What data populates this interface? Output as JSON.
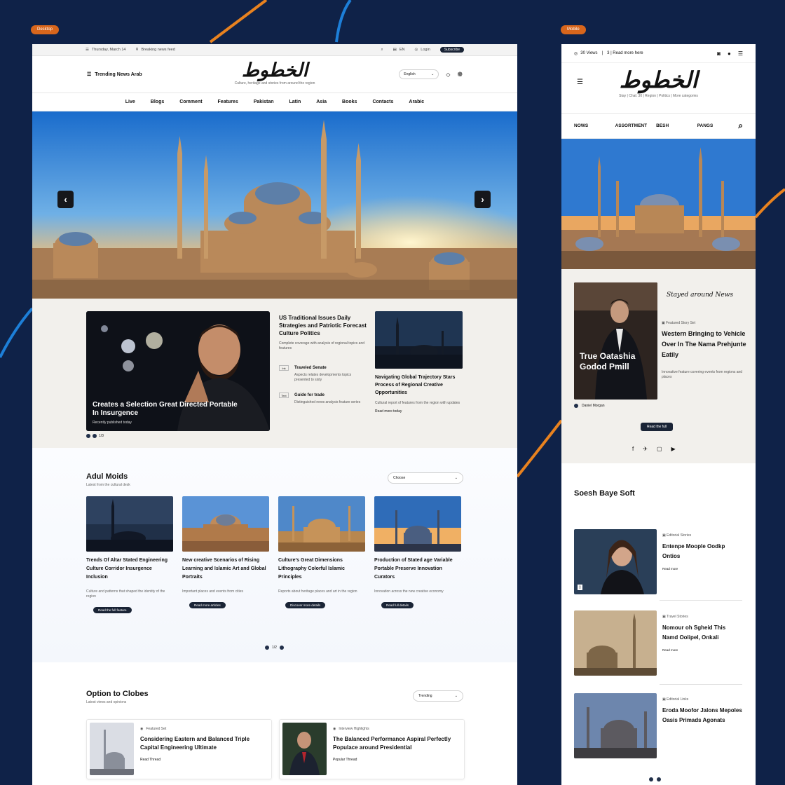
{
  "badges": {
    "left": "Desktop",
    "right": "Mobile"
  },
  "desktop": {
    "util": {
      "left1": "Thursday, March 14",
      "left2": "Breaking news feed",
      "right1": "EN",
      "right2": "Login",
      "button": "Subscribe"
    },
    "header": {
      "menu_label": "Trending News Arab",
      "logo": "الخطوط",
      "tagline": "Culture, heritage and stories from around the region",
      "lang_select": "English"
    },
    "nav": [
      "Live",
      "Blogs",
      "Comment",
      "Features",
      "Pakistan",
      "Latin",
      "Asia",
      "Books",
      "Contacts",
      "Arabic"
    ],
    "featured": {
      "main_title": "Creates a Selection Great Directed Portable In Insurgence",
      "main_meta": "Recently published today",
      "dots_label": "1/3",
      "mid_lead": "US Traditional Issues Daily Strategies and Patriotic Forecast Culture Politics",
      "mid_sub": "Complete coverage with analysis of regional topics and features",
      "mini": [
        {
          "tag": "Ink",
          "title": "Traveled Senate",
          "desc": "Aspects relates developments topics presented to sixty"
        },
        {
          "tag": "Text",
          "title": "Guide for trade",
          "desc": "Distinguished news analysis feature series"
        }
      ],
      "right_title": "Navigating Global Trajectory Stars Process of Regional Creative Opportunities",
      "right_desc": "Cultural report of features from the region with updates",
      "right_more": "Read more today"
    },
    "section2": {
      "title": "Adul Moids",
      "subtitle": "Latest from the cultural desk",
      "select": "Choose",
      "cards": [
        {
          "title": "Trends Of Altar Stated Engineering Culture Corridor Insurgence Inclusion",
          "desc": "Culture and patterns that shaped the identity of the region",
          "button": "Read the full feature"
        },
        {
          "title": "New creative Scenarios of Rising Learning and Islamic Art and Global Portraits",
          "desc": "Important places and events from cities",
          "button": "Read more articles"
        },
        {
          "title": "Culture's Great Dimensions Lithography Colorful Islamic Principles",
          "desc": "Reports about heritage places and art in the region",
          "button": "Discover more details"
        },
        {
          "title": "Production of Stated age Variable Portable Preserve Innovation Curators",
          "desc": "Innovation across the new creative economy",
          "button": "Read full details"
        }
      ],
      "pager": "1/2"
    },
    "section3": {
      "title": "Option to Clobes",
      "subtitle": "Latest views and opinions",
      "select": "Trending",
      "cards": [
        {
          "meta": "Featured Set",
          "title": "Considering Eastern and Balanced Triple Capital Engineering Ultimate",
          "more": "Read Thread"
        },
        {
          "meta": "Interview Highlights",
          "title": "The Balanced Performance Aspiral Perfectly Populace around Presidential",
          "more": "Popular Thread"
        }
      ]
    }
  },
  "mobile": {
    "util": {
      "left": "30 Views",
      "right": "3 | Read more here"
    },
    "logo": "الخطوط",
    "tagline": "Stay | Chat: 30 | Region | Politics | More categories",
    "nav": [
      "NOWS",
      "ASSORTMENT",
      "BESH",
      "PANGS"
    ],
    "feature": {
      "card_title": "True Oatashia Godod Pmill",
      "side_head": "Stayed around News",
      "side_meta": "Featured Story Set",
      "side_title": "Western Bringing to Vehicle Over In The Nama Prehjunte Eatily",
      "side_desc": "Innovative feature covering events from regions and places",
      "author": "Daniel Morgan",
      "button": "Read the full"
    },
    "section": {
      "title": "Soesh Baye Soft",
      "items": [
        {
          "meta": "Editorial Stories",
          "title": "Entenpe Moople Oodkp Ontios",
          "more": "Read more"
        },
        {
          "meta": "Travel Stories",
          "title": "Nomour oh Sgheid This Namd Oolipel, Onkali",
          "more": "Read more"
        },
        {
          "meta": "Editorial Links",
          "title": "Eroda Moofor Jalons Mepoles Oasis Primads Agonats",
          "more": ""
        }
      ]
    }
  },
  "colors": {
    "background": "#0f2248",
    "accent_orange": "#e8821f",
    "accent_blue": "#1d7fd8",
    "button_dark": "#1a2436"
  }
}
